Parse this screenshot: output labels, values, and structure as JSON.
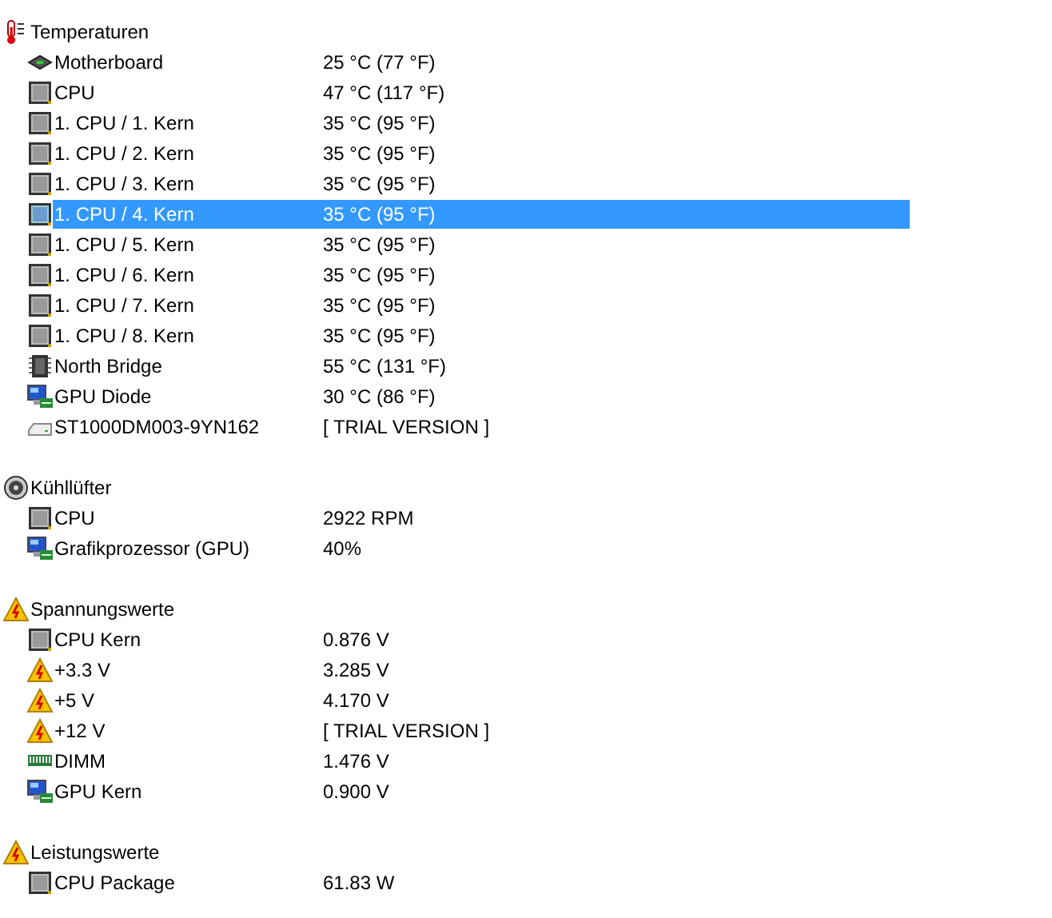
{
  "groups": [
    {
      "label": "Temperaturen",
      "kind": "thermometer",
      "items": [
        {
          "label": "Motherboard",
          "value": "25 °C  (77 °F)",
          "kind": "board",
          "selected": false
        },
        {
          "label": "CPU",
          "value": "47 °C  (117 °F)",
          "kind": "chip",
          "selected": false
        },
        {
          "label": "1. CPU / 1. Kern",
          "value": "35 °C  (95 °F)",
          "kind": "chip",
          "selected": false
        },
        {
          "label": "1. CPU / 2. Kern",
          "value": "35 °C  (95 °F)",
          "kind": "chip",
          "selected": false
        },
        {
          "label": "1. CPU / 3. Kern",
          "value": "35 °C  (95 °F)",
          "kind": "chip",
          "selected": false
        },
        {
          "label": "1. CPU / 4. Kern",
          "value": "35 °C  (95 °F)",
          "kind": "chip",
          "selected": true
        },
        {
          "label": "1. CPU / 5. Kern",
          "value": "35 °C  (95 °F)",
          "kind": "chip",
          "selected": false
        },
        {
          "label": "1. CPU / 6. Kern",
          "value": "35 °C  (95 °F)",
          "kind": "chip",
          "selected": false
        },
        {
          "label": "1. CPU / 7. Kern",
          "value": "35 °C  (95 °F)",
          "kind": "chip",
          "selected": false
        },
        {
          "label": "1. CPU / 8. Kern",
          "value": "35 °C  (95 °F)",
          "kind": "chip",
          "selected": false
        },
        {
          "label": "North Bridge",
          "value": "55 °C  (131 °F)",
          "kind": "bridge",
          "selected": false
        },
        {
          "label": "GPU Diode",
          "value": "30 °C  (86 °F)",
          "kind": "gpu",
          "selected": false
        },
        {
          "label": "ST1000DM003-9YN162",
          "value": "[ TRIAL VERSION ]",
          "kind": "disk",
          "selected": false
        }
      ]
    },
    {
      "label": "Kühllüfter",
      "kind": "fan",
      "items": [
        {
          "label": "CPU",
          "value": "2922 RPM",
          "kind": "chip",
          "selected": false
        },
        {
          "label": "Grafikprozessor (GPU)",
          "value": "40%",
          "kind": "gpu",
          "selected": false
        }
      ]
    },
    {
      "label": "Spannungswerte",
      "kind": "warning",
      "items": [
        {
          "label": "CPU Kern",
          "value": "0.876 V",
          "kind": "chip",
          "selected": false
        },
        {
          "label": "+3.3 V",
          "value": "3.285 V",
          "kind": "warning",
          "selected": false
        },
        {
          "label": "+5 V",
          "value": "4.170 V",
          "kind": "warning",
          "selected": false
        },
        {
          "label": "+12 V",
          "value": "[ TRIAL VERSION ]",
          "kind": "warning",
          "selected": false
        },
        {
          "label": "DIMM",
          "value": "1.476 V",
          "kind": "ram",
          "selected": false
        },
        {
          "label": "GPU Kern",
          "value": "0.900 V",
          "kind": "gpu",
          "selected": false
        }
      ]
    },
    {
      "label": "Leistungswerte",
      "kind": "warning",
      "items": [
        {
          "label": "CPU Package",
          "value": "61.83 W",
          "kind": "chip",
          "selected": false
        }
      ]
    }
  ]
}
